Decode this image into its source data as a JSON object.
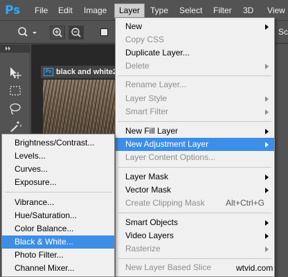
{
  "app": {
    "logo": "Ps",
    "accent": "#31a8ff"
  },
  "menubar": {
    "items": [
      {
        "label": "File"
      },
      {
        "label": "Edit"
      },
      {
        "label": "Image"
      },
      {
        "label": "Layer"
      },
      {
        "label": "Type"
      },
      {
        "label": "Select"
      },
      {
        "label": "Filter"
      },
      {
        "label": "3D"
      },
      {
        "label": "View"
      }
    ],
    "active": "Layer"
  },
  "options_bar": {
    "tool_icon": "zoom-icon",
    "zoom_in_icon": "zoom-in-icon",
    "zoom_out_icon": "zoom-out-icon",
    "right_label": "Sc"
  },
  "tools": [
    "move-tool-icon",
    "marquee-tool-icon",
    "lasso-tool-icon",
    "magic-wand-tool-icon"
  ],
  "document": {
    "tab_title": "black and white2"
  },
  "layer_menu": {
    "items": [
      {
        "label": "New",
        "submenu": true,
        "disabled": false
      },
      {
        "label": "Copy CSS",
        "disabled": true
      },
      {
        "label": "Duplicate Layer...",
        "disabled": false
      },
      {
        "label": "Delete",
        "submenu": true,
        "disabled": true
      },
      {
        "label": "Rename Layer...",
        "disabled": true
      },
      {
        "label": "Layer Style",
        "submenu": true,
        "disabled": true
      },
      {
        "label": "Smart Filter",
        "submenu": true,
        "disabled": true
      },
      {
        "label": "New Fill Layer",
        "submenu": true,
        "disabled": false
      },
      {
        "label": "New Adjustment Layer",
        "submenu": true,
        "disabled": false,
        "highlighted": true
      },
      {
        "label": "Layer Content Options...",
        "disabled": true
      },
      {
        "label": "Layer Mask",
        "submenu": true,
        "disabled": false
      },
      {
        "label": "Vector Mask",
        "submenu": true,
        "disabled": false
      },
      {
        "label": "Create Clipping Mask",
        "shortcut": "Alt+Ctrl+G",
        "disabled": true
      },
      {
        "label": "Smart Objects",
        "submenu": true,
        "disabled": false
      },
      {
        "label": "Video Layers",
        "submenu": true,
        "disabled": false
      },
      {
        "label": "Rasterize",
        "submenu": true,
        "disabled": true
      },
      {
        "label": "New Layer Based Slice",
        "disabled": true
      }
    ]
  },
  "adjustment_submenu": {
    "items": [
      {
        "label": "Brightness/Contrast..."
      },
      {
        "label": "Levels..."
      },
      {
        "label": "Curves..."
      },
      {
        "label": "Exposure..."
      },
      {
        "label": "Vibrance..."
      },
      {
        "label": "Hue/Saturation..."
      },
      {
        "label": "Color Balance..."
      },
      {
        "label": "Black & White...",
        "highlighted": true
      },
      {
        "label": "Photo Filter..."
      },
      {
        "label": "Channel Mixer..."
      }
    ]
  },
  "colors": {
    "highlight": "#3c8ee6",
    "menu_bg": "#f0f0f0",
    "disabled_text": "#8e8e8e",
    "chrome_bg": "#535353"
  },
  "watermark": "wtvid.com"
}
